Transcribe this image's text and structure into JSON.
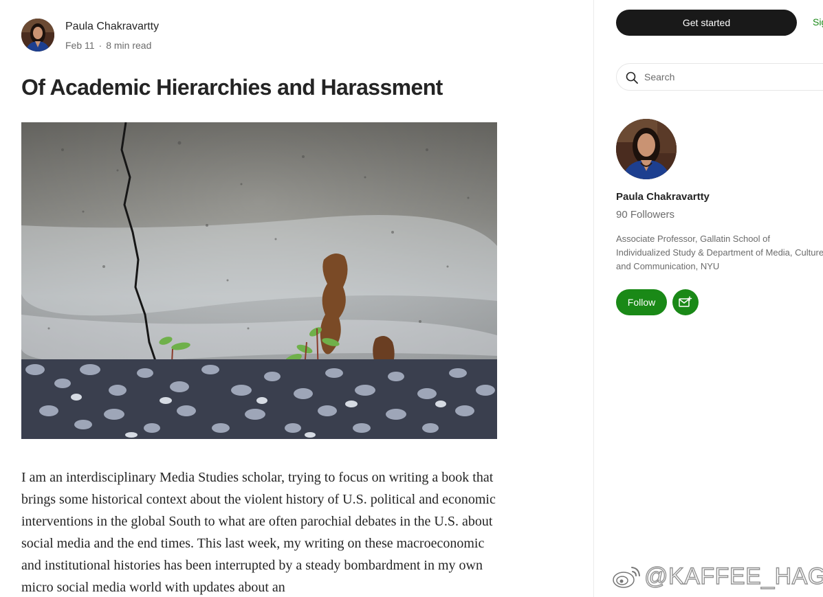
{
  "article": {
    "author": "Paula Chakravartty",
    "date": "Feb 11",
    "separator": "·",
    "read_time": "8 min read",
    "title": "Of Academic Hierarchies and Harassment",
    "hero_image_alt": "Plants growing from gravel at the base of a cracked concrete wall",
    "body": "I am an interdisciplinary Media Studies scholar, trying to focus on writing a book that brings some historical context about the violent history of U.S. political and economic interventions in the global South to what are often parochial debates in the U.S. about social media and the end times. This last week, my writing on these macroeconomic and institutional histories has been interrupted by a steady bombardment in my own micro social media world with updates about an"
  },
  "sidebar": {
    "get_started_label": "Get started",
    "sign_in_label": "Sign in",
    "search": {
      "placeholder": "Search",
      "value": ""
    },
    "profile": {
      "name": "Paula Chakravartty",
      "followers": "90 Followers",
      "bio": "Associate Professor, Gallatin School of Individualized Study & Department of Media, Culture and Communication, NYU",
      "follow_label": "Follow"
    }
  },
  "watermark": {
    "text": "@KAFFEE_HAG"
  },
  "colors": {
    "accent_green": "#1a8917",
    "button_dark": "#191919",
    "text_primary": "#242424",
    "text_secondary": "#6b6b6b",
    "divider": "#ebebeb"
  },
  "icons": {
    "search": "search-icon",
    "subscribe": "mail-plus-icon",
    "watermark": "weibo-icon"
  }
}
